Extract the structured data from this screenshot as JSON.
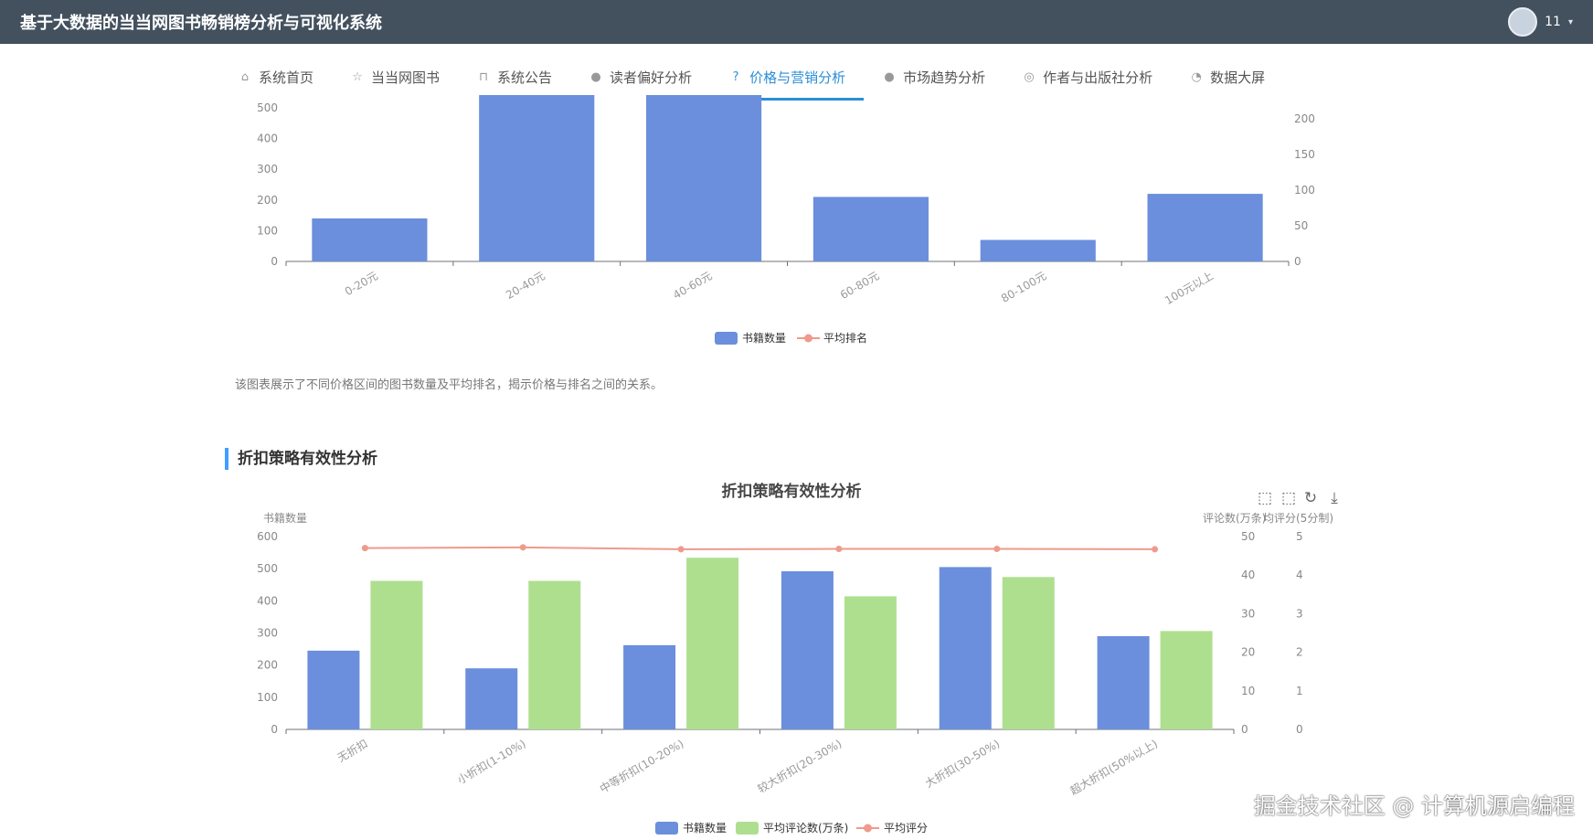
{
  "header": {
    "title": "基于大数据的当当网图书畅销榜分析与可视化系统",
    "username": "11"
  },
  "nav": [
    {
      "label": "系统首页",
      "icon": "home-icon",
      "glyph": "⌂"
    },
    {
      "label": "当当网图书",
      "icon": "star-icon",
      "glyph": "☆"
    },
    {
      "label": "系统公告",
      "icon": "bag-icon",
      "glyph": "⊓"
    },
    {
      "label": "读者偏好分析",
      "icon": "info-icon",
      "glyph": "●"
    },
    {
      "label": "价格与营销分析",
      "icon": "question-icon",
      "glyph": "?"
    },
    {
      "label": "市场趋势分析",
      "icon": "info-icon",
      "glyph": "●"
    },
    {
      "label": "作者与出版社分析",
      "icon": "target-icon",
      "glyph": "◎"
    },
    {
      "label": "数据大屏",
      "icon": "gauge-icon",
      "glyph": "◔"
    }
  ],
  "active_nav_index": 4,
  "chart1_description": "该图表展示了不同价格区间的图书数量及平均排名，揭示价格与排名之间的关系。",
  "section2_title": "折扣策略有效性分析",
  "watermark": "掘金技术社区 @ 计算机源启编程",
  "toolbox_icons": [
    "zoom-icon",
    "zoom-reset-icon",
    "restore-icon",
    "download-icon"
  ],
  "chart_data": [
    {
      "type": "bar",
      "title": "",
      "categories": [
        "0-20元",
        "20-40元",
        "40-60元",
        "60-80元",
        "80-100元",
        "100元以上"
      ],
      "series": [
        {
          "name": "书籍数量",
          "values": [
            140,
            560,
            560,
            210,
            70,
            220
          ],
          "axis": "left",
          "color": "#6b8fdc"
        },
        {
          "name": "平均排名",
          "values": [],
          "axis": "right",
          "color": "#ef9a8c",
          "kind": "line"
        }
      ],
      "yTicksLeft": [
        "0",
        "100",
        "200",
        "300",
        "400",
        "500"
      ],
      "yTicksRight": [
        "0",
        "50",
        "100",
        "150",
        "200"
      ],
      "ylim_left": [
        0,
        500
      ],
      "ylim_right": [
        0,
        200
      ],
      "legend_position": "bottom"
    },
    {
      "type": "bar",
      "title": "折扣策略有效性分析",
      "categories": [
        "无折扣",
        "小折扣(1-10%)",
        "中等折扣(10-20%)",
        "较大折扣(20-30%)",
        "大折扣(30-50%)",
        "超大折扣(50%以上)"
      ],
      "ylabel_left": "书籍数量",
      "ylabel_right": "评论数(万条)",
      "ylabel_right2": "均评分(5分制)",
      "series": [
        {
          "name": "书籍数量",
          "values": [
            245,
            190,
            262,
            492,
            505,
            290
          ],
          "axis": "left",
          "color": "#6b8fdc"
        },
        {
          "name": "平均评论数(万条)",
          "values": [
            38.5,
            38.5,
            44.5,
            34.5,
            39.5,
            25.5
          ],
          "axis": "right",
          "color": "#aedf8f"
        },
        {
          "name": "平均评分",
          "values": [
            4.7,
            4.72,
            4.67,
            4.68,
            4.68,
            4.67
          ],
          "axis": "right2",
          "color": "#ef9a8c",
          "kind": "line"
        }
      ],
      "yTicksLeft": [
        "0",
        "100",
        "200",
        "300",
        "400",
        "500",
        "600"
      ],
      "yTicksRight": [
        "0",
        "10",
        "20",
        "30",
        "40",
        "50"
      ],
      "yTicksRight2": [
        "0",
        "1",
        "2",
        "3",
        "4",
        "5"
      ],
      "ylim_left": [
        0,
        600
      ],
      "ylim_right": [
        0,
        50
      ],
      "ylim_right2": [
        0,
        5
      ],
      "legend_position": "bottom"
    }
  ]
}
